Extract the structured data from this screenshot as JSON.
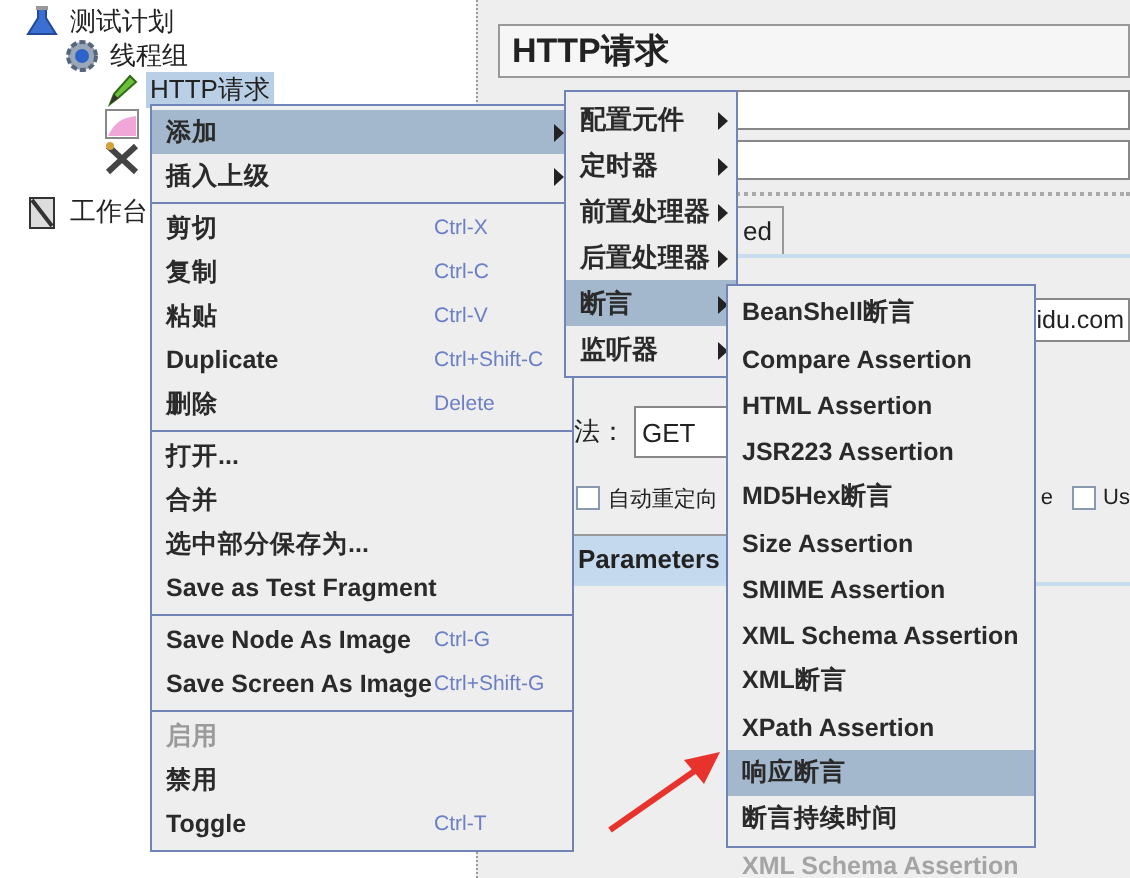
{
  "tree": {
    "items": [
      {
        "label": "测试计划",
        "kind": "plan",
        "selected": false,
        "children": [
          {
            "label": "线程组",
            "kind": "thread-group",
            "selected": false,
            "children": [
              {
                "label": "HTTP请求",
                "kind": "sampler",
                "selected": true
              },
              {
                "kind": "listener",
                "selected": false
              },
              {
                "kind": "tool",
                "selected": false
              }
            ]
          }
        ]
      },
      {
        "label": "工作台",
        "kind": "workbench",
        "selected": false
      }
    ]
  },
  "panel": {
    "title": "HTTP请求",
    "tab_fragment": "ed",
    "server_fragment": "idu.com",
    "method_label": "法：",
    "method_value": "GET",
    "checkboxes": [
      {
        "label": "自动重定向",
        "checked": false
      }
    ],
    "checkbox_fragment": "e",
    "checkboxes_right": [
      {
        "label": "Us",
        "checked": false
      }
    ],
    "tabs": [
      {
        "label": "Parameters",
        "selected": true
      }
    ],
    "ghost_text": "XML Schema Assertion"
  },
  "context_menu": {
    "groups": [
      [
        {
          "label": "添加",
          "submenu": true,
          "selected": true,
          "disabled": false
        },
        {
          "label": "插入上级",
          "submenu": true,
          "selected": false,
          "disabled": false
        }
      ],
      [
        {
          "label": "剪切",
          "shortcut": "Ctrl-X",
          "submenu": false,
          "selected": false,
          "disabled": false
        },
        {
          "label": "复制",
          "shortcut": "Ctrl-C",
          "submenu": false,
          "selected": false,
          "disabled": false
        },
        {
          "label": "粘贴",
          "shortcut": "Ctrl-V",
          "submenu": false,
          "selected": false,
          "disabled": false
        },
        {
          "label": "Duplicate",
          "shortcut": "Ctrl+Shift-C",
          "submenu": false,
          "selected": false,
          "disabled": false
        },
        {
          "label": "删除",
          "shortcut": "Delete",
          "submenu": false,
          "selected": false,
          "disabled": false
        }
      ],
      [
        {
          "label": "打开...",
          "submenu": false,
          "selected": false,
          "disabled": false
        },
        {
          "label": "合并",
          "submenu": false,
          "selected": false,
          "disabled": false
        },
        {
          "label": "选中部分保存为...",
          "submenu": false,
          "selected": false,
          "disabled": false
        },
        {
          "label": "Save as Test Fragment",
          "submenu": false,
          "selected": false,
          "disabled": false
        }
      ],
      [
        {
          "label": "Save Node As Image",
          "shortcut": "Ctrl-G",
          "submenu": false,
          "selected": false,
          "disabled": false
        },
        {
          "label": "Save Screen As Image",
          "shortcut": "Ctrl+Shift-G",
          "submenu": false,
          "selected": false,
          "disabled": false
        }
      ],
      [
        {
          "label": "启用",
          "submenu": false,
          "selected": false,
          "disabled": true
        },
        {
          "label": "禁用",
          "submenu": false,
          "selected": false,
          "disabled": false
        },
        {
          "label": "Toggle",
          "shortcut": "Ctrl-T",
          "submenu": false,
          "selected": false,
          "disabled": false
        }
      ]
    ]
  },
  "add_submenu": {
    "items": [
      {
        "label": "配置元件",
        "submenu": true,
        "selected": false
      },
      {
        "label": "定时器",
        "submenu": true,
        "selected": false
      },
      {
        "label": "前置处理器",
        "submenu": true,
        "selected": false
      },
      {
        "label": "后置处理器",
        "submenu": true,
        "selected": false
      },
      {
        "label": "断言",
        "submenu": true,
        "selected": true
      },
      {
        "label": "监听器",
        "submenu": true,
        "selected": false
      }
    ]
  },
  "assertion_submenu": {
    "items": [
      {
        "label": "BeanShell断言",
        "selected": false
      },
      {
        "label": "Compare Assertion",
        "selected": false
      },
      {
        "label": "HTML Assertion",
        "selected": false
      },
      {
        "label": "JSR223 Assertion",
        "selected": false
      },
      {
        "label": "MD5Hex断言",
        "selected": false
      },
      {
        "label": "Size Assertion",
        "selected": false
      },
      {
        "label": "SMIME Assertion",
        "selected": false
      },
      {
        "label": "XML Schema Assertion",
        "selected": false
      },
      {
        "label": "XML断言",
        "selected": false
      },
      {
        "label": "XPath Assertion",
        "selected": false
      },
      {
        "label": "响应断言",
        "selected": true
      },
      {
        "label": "断言持续时间",
        "selected": false
      }
    ]
  }
}
